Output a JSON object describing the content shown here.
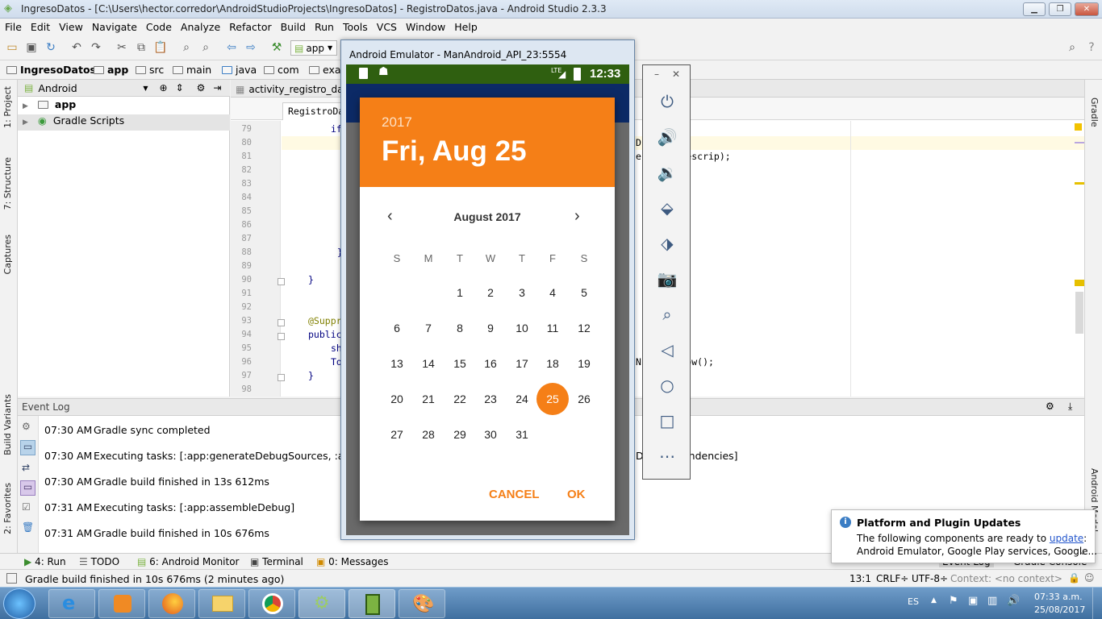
{
  "window": {
    "title": "IngresoDatos - [C:\\Users\\hector.corredor\\AndroidStudioProjects\\IngresoDatos] - RegistroDatos.java - Android Studio 2.3.3"
  },
  "menu": [
    "File",
    "Edit",
    "View",
    "Navigate",
    "Code",
    "Analyze",
    "Refactor",
    "Build",
    "Run",
    "Tools",
    "VCS",
    "Window",
    "Help"
  ],
  "toolbar": {
    "run_config": "app"
  },
  "breadcrumb": [
    "IngresoDatos",
    "app",
    "src",
    "main",
    "java",
    "com",
    "exa"
  ],
  "project_panel": {
    "view_mode": "Android",
    "items": [
      "app",
      "Gradle Scripts"
    ]
  },
  "left_tabs": [
    "1: Project",
    "7: Structure",
    "Captures",
    "Build Variants",
    "2: Favorites"
  ],
  "right_tabs": [
    "Gradle",
    "Android Model"
  ],
  "editor": {
    "tab": "activity_registro_dato",
    "subtab": "RegistroDa",
    "lines": [
      "79",
      "80",
      "81",
      "82",
      "83",
      "84",
      "85",
      "86",
      "87",
      "88",
      "89",
      "90",
      "91",
      "92",
      "93",
      "94",
      "95",
      "96",
      "97",
      "98"
    ],
    "code": [
      {
        "line": 0,
        "indent": "if",
        "right": ""
      },
      {
        "line": 1,
        "indent": "",
        "right": "D   s);"
      },
      {
        "line": 2,
        "indent": "",
        "right": "e   il, descrip);"
      },
      {
        "line": 9,
        "indent": "}",
        "right": ""
      },
      {
        "line": 11,
        "indent": "}",
        "right": ""
      },
      {
        "line": 14,
        "indent": "@Suppr",
        "right": ""
      },
      {
        "line": 15,
        "indent": "public",
        "right": ""
      },
      {
        "line": 16,
        "indent": "sh",
        "right": ""
      },
      {
        "line": 17,
        "indent": "To",
        "right": "N   T).show();"
      },
      {
        "line": 18,
        "indent": "}",
        "right": ""
      }
    ]
  },
  "event_log": {
    "title": "Event Log",
    "entries": [
      {
        "time": "07:30 AM",
        "message": "Gradle sync completed"
      },
      {
        "time": "07:30 AM",
        "message": "Executing tasks: [:app:generateDebugSources, :app:genera"
      },
      {
        "time": "07:30 AM",
        "message": "Gradle build finished in 13s 612ms"
      },
      {
        "time": "07:31 AM",
        "message": "Executing tasks: [:app:assembleDebug]"
      },
      {
        "time": "07:31 AM",
        "message": "Gradle build finished in 10s 676ms"
      }
    ],
    "entry2_tail": "De   stDependencies]"
  },
  "bottom_tabs": [
    "4: Run",
    "TODO",
    "6: Android Monitor",
    "Terminal",
    "0: Messages",
    "Event Log",
    "Gradle Console"
  ],
  "status": {
    "message": "Gradle build finished in 10s 676ms (2 minutes ago)",
    "position": "13:1",
    "line_sep": "CRLF÷",
    "encoding": "UTF-8÷",
    "context": "Context: <no context>"
  },
  "emulator": {
    "title": "Android Emulator - ManAndroid_API_23:5554",
    "time": "12:33",
    "network": "LTE",
    "dialog": {
      "year": "2017",
      "date": "Fri, Aug 25",
      "month": "August 2017",
      "weekdays": [
        "S",
        "M",
        "T",
        "W",
        "T",
        "F",
        "S"
      ],
      "first_weekday_index": 2,
      "days": 31,
      "selected": 25,
      "cancel": "CANCEL",
      "ok": "OK"
    },
    "side_controls": [
      "power-icon",
      "volume-up-icon",
      "volume-down-icon",
      "rotate-left-icon",
      "rotate-right-icon",
      "camera-icon",
      "zoom-icon",
      "back-icon",
      "home-icon",
      "overview-icon",
      "more-icon"
    ]
  },
  "notification": {
    "title": "Platform and Plugin Updates",
    "line1_prefix": "The following components are ready to ",
    "link": "update",
    "line1_suffix": ":",
    "line2": "Android Emulator, Google Play services, Google..."
  },
  "taskbar": {
    "lang": "ES",
    "time": "07:33 a.m.",
    "date": "25/08/2017"
  }
}
